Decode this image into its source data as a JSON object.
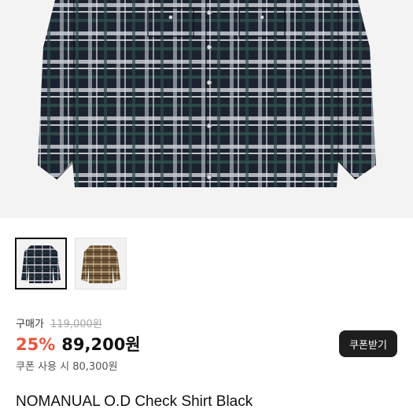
{
  "gallery": {
    "thumbnails": [
      {
        "name": "black-check-shirt",
        "selected": true,
        "colors": [
          "#1d2432",
          "#e4e6ea",
          "#2b4a47"
        ]
      },
      {
        "name": "brown-check-shirt",
        "selected": false,
        "colors": [
          "#6e5436",
          "#d7c6a4",
          "#3f3224"
        ]
      }
    ]
  },
  "price": {
    "label": "구매가",
    "original": "119,000원",
    "discount": "25%",
    "sale": "89,200원",
    "coupon_price": "쿠폰 사용 시 80,300원",
    "coupon_button": "쿠폰받기"
  },
  "product": {
    "title": "NOMANUAL O.D Check Shirt Black"
  },
  "colors": {
    "discount": "#e8553b",
    "button_bg": "#1e1e1e"
  }
}
